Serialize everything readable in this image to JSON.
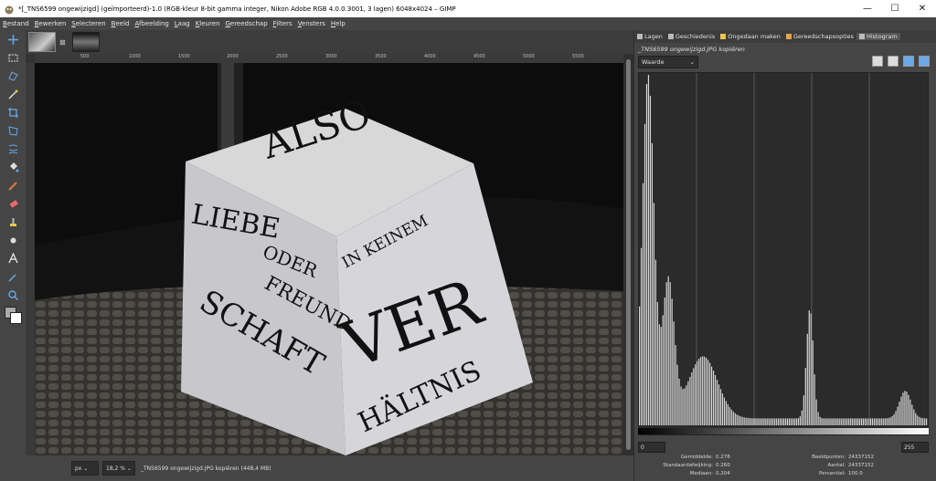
{
  "window": {
    "title": "*[_TNS6599 ongewijzigd] (geïmporteerd)-1.0 (RGB-kleur 8-bit gamma integer, Nikon Adobe RGB 4.0.0.3001, 3 lagen) 6048x4024 – GIMP",
    "minimize": "—",
    "maximize": "☐",
    "close": "✕"
  },
  "menu": [
    "Bestand",
    "Bewerken",
    "Selecteren",
    "Beeld",
    "Afbeelding",
    "Laag",
    "Kleuren",
    "Gereedschap",
    "Filters",
    "Vensters",
    "Help"
  ],
  "ruler": {
    "top_ticks": [
      "500",
      "1000",
      "1500",
      "2000",
      "2500",
      "3000",
      "3500",
      "4000",
      "4500",
      "5000",
      "5500"
    ]
  },
  "photo": {
    "words": [
      "LIEBE",
      "ODER",
      "FREUND",
      "SCHAFT",
      "ALSO",
      "IN KEINEM",
      "VER",
      "HÄLTNIS"
    ]
  },
  "statusbar": {
    "unit": "px",
    "zoom": "18,2 %",
    "info": "_TNS6599 ongewijzigd.JPG kopiëren (448,4 MB)"
  },
  "dock": {
    "tabs": [
      "Lagen",
      "Geschiedenis",
      "Ongedaan maken",
      "Gereedschapsopties",
      "Histogram"
    ],
    "active_tab": "Histogram",
    "layer_name": "_TNS6599 ongewijzigd.JPG kopiëren",
    "channel": "Waarde",
    "range_min": "0",
    "range_max": "255",
    "stats": {
      "mean_label": "Gemiddelde:",
      "mean": "0.278",
      "std_label": "Standaardafwijking:",
      "std": "0.260",
      "median_label": "Mediaan:",
      "median": "0.204",
      "pixels_label": "Beeldpunten:",
      "pixels": "24337152",
      "count_label": "Aantal:",
      "count": "24337152",
      "percentile_label": "Percentiel:",
      "percentile": "100.0"
    }
  },
  "colors": {
    "window_bg": "#454545",
    "canvas_bg": "#161616",
    "histogram_bar": "#d9d9d9"
  }
}
